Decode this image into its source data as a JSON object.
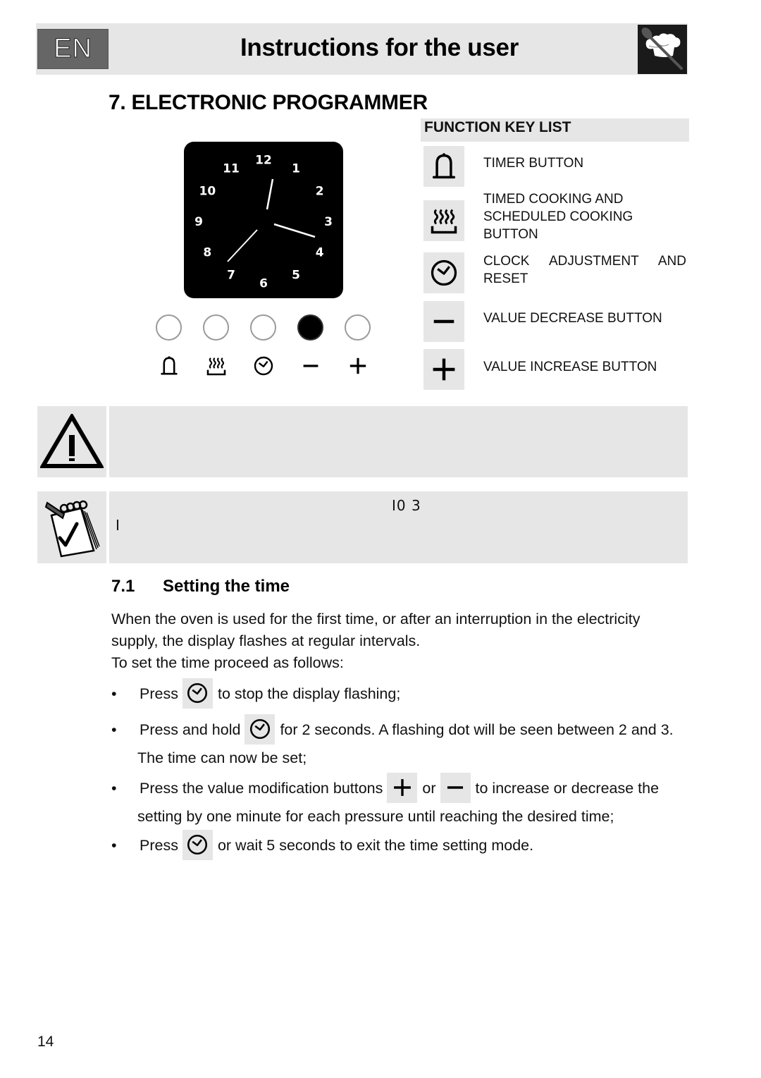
{
  "header": {
    "language_badge": "EN",
    "title": "Instructions for the user",
    "logo_icon": "chef-hat-spoon-icon"
  },
  "section": {
    "title": "7. ELECTRONIC PROGRAMMER"
  },
  "clock_display": {
    "dial_numbers": [
      "12",
      "1",
      "2",
      "3",
      "4",
      "5",
      "6",
      "7",
      "8",
      "9",
      "10",
      "11"
    ],
    "hands": {
      "hour": "12 (slightly past)",
      "minute": "~3:20 position",
      "second": "~7:30 position"
    }
  },
  "control_panel": {
    "indicators": [
      {
        "key": "timer",
        "active": false
      },
      {
        "key": "cooking",
        "active": false
      },
      {
        "key": "clock",
        "active": false
      },
      {
        "key": "minus",
        "active": true
      },
      {
        "key": "plus",
        "active": false
      }
    ],
    "icons": [
      "bell-icon",
      "steam-tray-icon",
      "clock-icon",
      "minus-icon",
      "plus-icon"
    ]
  },
  "function_key_list": {
    "heading": "FUNCTION KEY LIST",
    "items": [
      {
        "icon": "bell-icon",
        "label": "TIMER BUTTON"
      },
      {
        "icon": "steam-tray-icon",
        "label": "TIMED COOKING AND SCHEDULED COOKING BUTTON"
      },
      {
        "icon": "clock-icon",
        "label": "CLOCK ADJUSTMENT AND RESET"
      },
      {
        "icon": "minus-icon",
        "label": "VALUE DECREASE BUTTON"
      },
      {
        "icon": "plus-icon",
        "label": "VALUE INCREASE BUTTON"
      }
    ]
  },
  "warning_box": {
    "icon": "warning-triangle-icon",
    "text": ""
  },
  "note_box": {
    "icon": "notepad-check-icon",
    "line1": "I0 3",
    "line2": "I"
  },
  "subsection": {
    "number": "7.1",
    "title": "Setting the time",
    "intro_line1": "When the oven is used for the first time, or after an interruption in the electricity supply, the display flashes at regular intervals.",
    "intro_line2": "To set the time proceed as follows:"
  },
  "steps": [
    {
      "before": "Press",
      "icon": "clock-icon",
      "after": "to stop the display flashing;"
    },
    {
      "before": "Press and hold",
      "icon": "clock-icon",
      "after": "for 2 seconds. A flashing dot will be seen between 2 and 3. The time can now be set;"
    },
    {
      "before": "Press the value modification buttons",
      "icon": "plus-icon",
      "middle": "or",
      "icon2": "minus-icon",
      "after": "to increase or decrease the setting by one minute for each pressure until reaching the desired time;"
    },
    {
      "before": "Press",
      "icon": "clock-icon",
      "after": "or wait 5 seconds to exit the time setting mode."
    }
  ],
  "bullet_char": "•",
  "page_number": "14"
}
